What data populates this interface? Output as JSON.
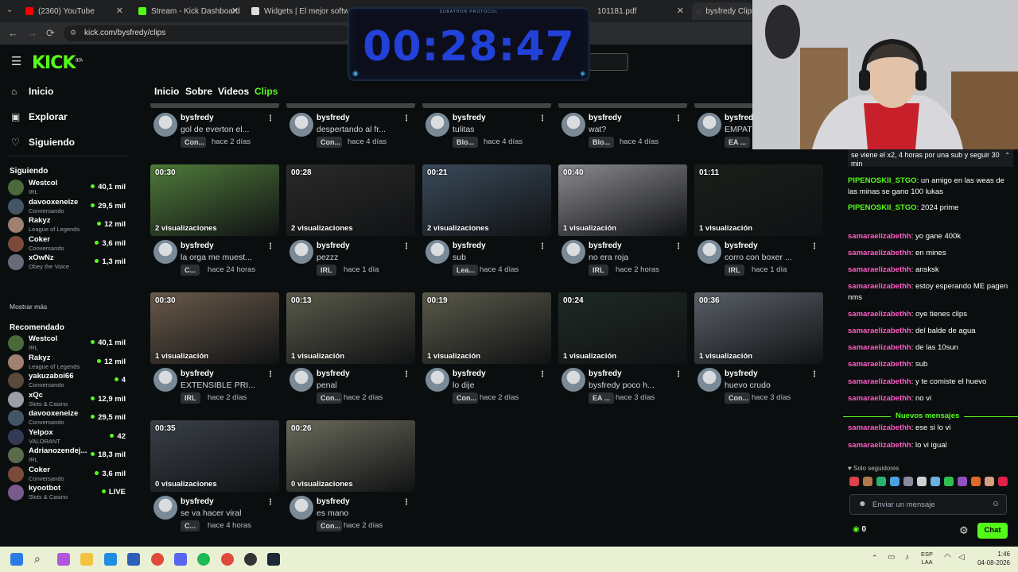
{
  "browser": {
    "tabs": [
      {
        "label": "(2360) YouTube",
        "color": "#ff0000"
      },
      {
        "label": "Stream - Kick Dashboard",
        "color": "#53fc18"
      },
      {
        "label": "Widgets | El mejor softwar",
        "color": "#dddddd"
      },
      {
        "label": "101181.pdf",
        "color": "#888888"
      },
      {
        "label": "bysfredy Clips -",
        "color": "#888888"
      }
    ],
    "url": "kick.com/bysfredy/clips"
  },
  "kick": {
    "logo": "KICK",
    "logo_sup": "BETA",
    "nav": [
      {
        "label": "Inicio",
        "icon": "home-icon"
      },
      {
        "label": "Explorar",
        "icon": "compass-icon"
      },
      {
        "label": "Siguiendo",
        "icon": "heart-icon"
      }
    ],
    "following_header": "Siguiendo",
    "following": [
      {
        "name": "Westcol",
        "game": "IRL",
        "viewers": "40,1 mil",
        "color": "#4a6a3a"
      },
      {
        "name": "davooxeneize",
        "game": "Conversando",
        "viewers": "29,5 mil",
        "color": "#445566"
      },
      {
        "name": "Rakyz",
        "game": "League of Legends",
        "viewers": "12 mil",
        "color": "#a08070"
      },
      {
        "name": "Coker",
        "game": "Conversando",
        "viewers": "3,6 mil",
        "color": "#7a4a3a"
      },
      {
        "name": "xOwNz",
        "game": "Obey the Voice",
        "viewers": "1,3 mil",
        "color": "#6a6a7a"
      }
    ],
    "show_more": "Mostrar más",
    "recommended_header": "Recomendado",
    "recommended": [
      {
        "name": "Westcol",
        "game": "IRL",
        "viewers": "40,1 mil",
        "color": "#4a6a3a"
      },
      {
        "name": "Rakyz",
        "game": "League of Legends",
        "viewers": "12 mil",
        "color": "#a08070"
      },
      {
        "name": "yakuzaboi66",
        "game": "Conversando",
        "viewers": "4",
        "color": "#5a4a3a"
      },
      {
        "name": "xQc",
        "game": "Slots & Casino",
        "viewers": "12,9 mil",
        "color": "#9aa0a8"
      },
      {
        "name": "davooxeneize",
        "game": "Conversando",
        "viewers": "29,5 mil",
        "color": "#445566"
      },
      {
        "name": "Yelpox",
        "game": "VALORANT",
        "viewers": "42",
        "color": "#333a55"
      },
      {
        "name": "Adrianozendej...",
        "game": "IRL",
        "viewers": "18,3 mil",
        "color": "#5a6a4a"
      },
      {
        "name": "Coker",
        "game": "Conversando",
        "viewers": "3,6 mil",
        "color": "#7a4a3a"
      },
      {
        "name": "kyootbot",
        "game": "Slots & Casino",
        "viewers": "LIVE",
        "color": "#7a5a8a"
      }
    ],
    "channel_tabs": [
      "Inicio",
      "Sobre",
      "Videos",
      "Clips"
    ],
    "clips_row0": [
      {
        "channel": "bysfredy",
        "title": "gol de everton el...",
        "badge": "Con...",
        "ago": "hace 2 días"
      },
      {
        "channel": "bysfredy",
        "title": "despertando al fr...",
        "badge": "Con...",
        "ago": "hace 4 días"
      },
      {
        "channel": "bysfredy",
        "title": "tulitas",
        "badge": "Blo...",
        "ago": "hace 4 días"
      },
      {
        "channel": "bysfredy",
        "title": "wat?",
        "badge": "Blo...",
        "ago": "hace 4 días"
      },
      {
        "channel": "bysfredy",
        "title": "EMPAT",
        "badge": "EA ...",
        "ago": ""
      }
    ],
    "clips": [
      {
        "duration": "00:30",
        "views": "2 visualizaciones",
        "channel": "bysfredy",
        "title": "la orga me muest...",
        "badge": "C...",
        "ago": "hace 24 horas",
        "bg": "#4f7a3a"
      },
      {
        "duration": "00:28",
        "views": "2 visualizaciones",
        "channel": "bysfredy",
        "title": "pezzz",
        "badge": "IRL",
        "ago": "hace 1 día",
        "bg": "#2a2a2a"
      },
      {
        "duration": "00:21",
        "views": "2 visualizaciones",
        "channel": "bysfredy",
        "title": "sub",
        "badge": "Lea...",
        "ago": "hace 4 días",
        "bg": "#3a4a5a"
      },
      {
        "duration": "00:40",
        "views": "1 visualización",
        "channel": "bysfredy",
        "title": "no era roja",
        "badge": "IRL",
        "ago": "hace 2 horas",
        "bg": "#8a8a90"
      },
      {
        "duration": "01:11",
        "views": "1 visualización",
        "channel": "bysfredy",
        "title": "corro con boxer ...",
        "badge": "IRL",
        "ago": "hace 1 día",
        "bg": "#1a1f1a"
      },
      {
        "duration": "00:30",
        "views": "1 visualización",
        "channel": "bysfredy",
        "title": "EXTENSIBLE PRI...",
        "badge": "IRL",
        "ago": "hace 2 días",
        "bg": "#6a5a4a"
      },
      {
        "duration": "00:13",
        "views": "1 visualización",
        "channel": "bysfredy",
        "title": "penal",
        "badge": "Con...",
        "ago": "hace 2 días",
        "bg": "#5a5a4a"
      },
      {
        "duration": "00:19",
        "views": "1 visualización",
        "channel": "bysfredy",
        "title": "lo dije",
        "badge": "Con...",
        "ago": "hace 2 días",
        "bg": "#5a5a4a"
      },
      {
        "duration": "00:24",
        "views": "1 visualización",
        "channel": "bysfredy",
        "title": "bysfredy poco h...",
        "badge": "EA ...",
        "ago": "hace 3 días",
        "bg": "#1f2a24"
      },
      {
        "duration": "00:36",
        "views": "1 visualización",
        "channel": "bysfredy",
        "title": "huevo crudo",
        "badge": "Con...",
        "ago": "hace 3 días",
        "bg": "#5a6068"
      },
      {
        "duration": "00:35",
        "views": "0 visualizaciones",
        "channel": "bysfredy",
        "title": "se va hacer viral",
        "badge": "C...",
        "ago": "hace 4 horas",
        "bg": "#3a4048"
      },
      {
        "duration": "00:26",
        "views": "0 visualizaciones",
        "channel": "bysfredy",
        "title": "es mano",
        "badge": "Con...",
        "ago": "hace 2 días",
        "bg": "#6a6a5a"
      }
    ]
  },
  "timer": {
    "label": "SUBATHON PROTOCOL",
    "value": "00:28:47"
  },
  "chat": {
    "pinned": "se viene el x2, 4 horas por una sub y seguir 30 min",
    "messages": [
      {
        "user": "PIPENOSKII_STGO",
        "text": "un amigo en las weas de las minas se gano 100 lukas",
        "color": "#53fc18"
      },
      {
        "user": "PIPENOSKII_STGO",
        "text": "2024 prime",
        "color": "#53fc18"
      },
      {
        "user": "samaraelizabethh",
        "text": "yo gane 400k",
        "color": "#ff5cc8"
      },
      {
        "user": "samaraelizabethh",
        "text": "en mines",
        "color": "#ff5cc8"
      },
      {
        "user": "samaraelizabethh",
        "text": "ansksk",
        "color": "#ff5cc8"
      },
      {
        "user": "samaraelizabethh",
        "text": "estoy esperando ME pagen nms",
        "color": "#ff5cc8"
      },
      {
        "user": "samaraelizabethh",
        "text": "oye tienes clips",
        "color": "#ff5cc8"
      },
      {
        "user": "samaraelizabethh",
        "text": "del balde de agua",
        "color": "#ff5cc8"
      },
      {
        "user": "samaraelizabethh",
        "text": "de las 10sun",
        "color": "#ff5cc8"
      },
      {
        "user": "samaraelizabethh",
        "text": "sub",
        "color": "#ff5cc8"
      },
      {
        "user": "samaraelizabethh",
        "text": "y te comiste el huevo",
        "color": "#ff5cc8"
      },
      {
        "user": "samaraelizabethh",
        "text": "no vi",
        "color": "#ff5cc8"
      },
      {
        "user": "samaraelizabethh",
        "text": "ese si lo vi",
        "color": "#ff5cc8"
      },
      {
        "user": "samaraelizabethh",
        "text": "lo vi igual",
        "color": "#ff5cc8"
      }
    ],
    "new_messages": "Nuevos mensajes",
    "followers_only": "Solo seguidores",
    "input_placeholder": "Enviar un mensaje",
    "count": "0",
    "chat_button": "Chat"
  },
  "taskbar": {
    "lang": "ESP",
    "lang2": "LAA",
    "time": "1:46",
    "date": "04-08-2026"
  },
  "colors": {
    "accent": "#53fc18",
    "bg": "#0b0e0f"
  }
}
